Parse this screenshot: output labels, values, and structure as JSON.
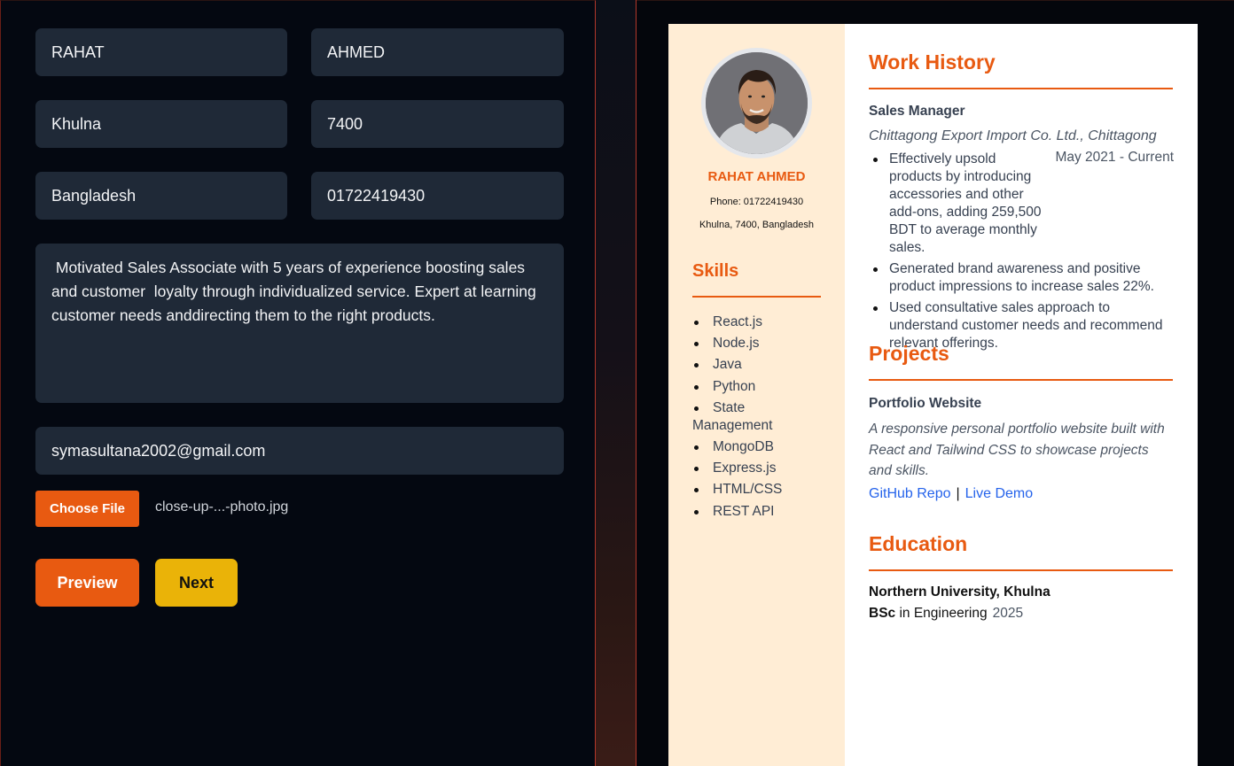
{
  "form": {
    "first_name": "RAHAT",
    "last_name": "AHMED",
    "city": "Khulna",
    "postal_code": "7400",
    "country": "Bangladesh",
    "phone": "01722419430",
    "summary": " Motivated Sales Associate with 5 years of experience boosting sales and customer  loyalty through individualized service. Expert at learning customer needs anddirecting them to the right products.",
    "email": "symasultana2002@gmail.com",
    "choose_file_label": "Choose File",
    "file_name": "close-up-...-photo.jpg",
    "preview_label": "Preview",
    "next_label": "Next"
  },
  "resume": {
    "name": "RAHAT AHMED",
    "phone_line": "Phone: 01722419430",
    "address_line": "Khulna, 7400, Bangladesh",
    "skills_title": "Skills",
    "skills": [
      "React.js",
      "Node.js",
      "Java",
      "Python",
      "State Management",
      "MongoDB",
      "Express.js",
      "HTML/CSS",
      "REST API"
    ],
    "work_title": "Work History",
    "job": {
      "title": "Sales Manager",
      "company": "Chittagong Export Import Co. Ltd., Chittagong",
      "dates": "May 2021 - Current",
      "bullets": [
        "Effectively upsold products by introducing accessories and other add-ons, adding 259,500 BDT to average monthly sales.",
        "Generated brand awareness and positive product impressions to increase sales 22%.",
        "Used consultative sales approach to understand customer needs and recommend relevant offerings."
      ]
    },
    "projects_title": "Projects",
    "project": {
      "title": "Portfolio Website",
      "description": "A responsive personal portfolio website built with React and Tailwind CSS to showcase projects and skills.",
      "repo_label": "GitHub Repo",
      "separator": "|",
      "demo_label": "Live Demo"
    },
    "education_title": "Education",
    "education": {
      "school": "Northern University, Khulna",
      "degree": "BSc",
      "field": " in Engineering",
      "year": "2025"
    }
  },
  "colors": {
    "accent": "#e85a11",
    "next_button": "#eab308",
    "field_bg": "#1f2937",
    "sidebar_bg": "#ffedd5",
    "link": "#2563eb"
  }
}
